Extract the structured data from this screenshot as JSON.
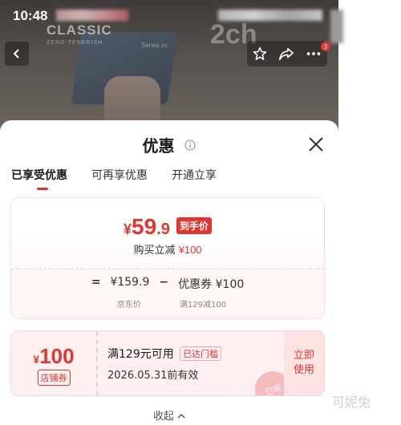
{
  "status_bar": {
    "time": "10:48"
  },
  "background_photo": {
    "brand_text": "CLASSIC",
    "brand_subtext": "ZERO-TENERISH",
    "series_text": "Series xx",
    "overlay_text": "2ch"
  },
  "top_bar": {
    "notification_count": "3"
  },
  "sheet": {
    "title": "优惠",
    "tabs": [
      {
        "label": "已享受优惠",
        "active": true
      },
      {
        "label": "可再享优惠",
        "active": false
      },
      {
        "label": "开通立享",
        "active": false
      }
    ],
    "price_card": {
      "currency": "¥",
      "price_int": "59",
      "price_dec": ".9",
      "final_tag": "到手价",
      "discount_label": "购买立减",
      "discount_value": "¥100",
      "formula": {
        "eq": "=",
        "original_price": "¥159.9",
        "minus": "−",
        "coupon_part": "优惠券 ¥100",
        "original_label": "京东价",
        "coupon_label": "满129减100"
      }
    },
    "coupon": {
      "currency": "¥",
      "amount": "100",
      "type": "店铺券",
      "condition": "满129元可用",
      "reached_tag": "已达门槛",
      "expiry": "2026.05.31前有效",
      "use_label_line1": "立即",
      "use_label_line2": "使用",
      "stamp_text": "已领"
    },
    "collapse_label": "收起"
  },
  "watermark": "可妮兔",
  "colors": {
    "accent": "#e5342f",
    "card_tint": "#fff6f6"
  }
}
